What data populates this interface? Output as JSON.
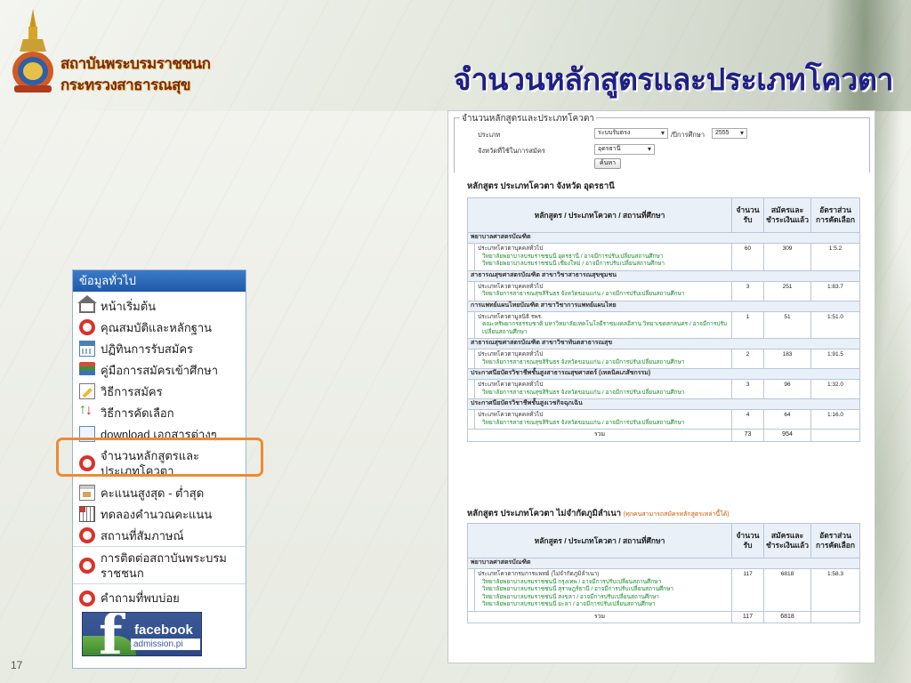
{
  "header": {
    "org_line1": "สถาบันพระบรมราชชนก",
    "org_line2": "กระทรวงสาธารณสุข",
    "slide_title": "จำนวนหลักสูตรและประเภทโควตา",
    "slide_number": "17"
  },
  "sidebar": {
    "title": "ข้อมูลทั่วไป",
    "items": [
      {
        "label": "หน้าเริ่มต้น",
        "icon": "home-icon"
      },
      {
        "label": "คุณสมบัติและหลักฐาน",
        "icon": "lifebuoy-icon"
      },
      {
        "label": "ปฏิทินการรับสมัคร",
        "icon": "calendar-icon"
      },
      {
        "label": "คู่มือการสมัครเข้าศึกษา",
        "icon": "books-icon"
      },
      {
        "label": "วิธีการสมัคร",
        "icon": "pencil-icon"
      },
      {
        "label": "วิธีการคัดเลือก",
        "icon": "updown-arrows-icon"
      },
      {
        "label": "download เอกสารต่างๆ",
        "icon": "document-icon"
      },
      {
        "label": "จำนวนหลักสูตรและประเภทโควตา",
        "icon": "lifebuoy-icon"
      },
      {
        "label": "คะแนนสูงสุด - ต่ำสุด",
        "icon": "chart-icon"
      },
      {
        "label": "ทดลองคำนวณคะแนน",
        "icon": "calculator-icon"
      },
      {
        "label": "สถานที่สัมภาษณ์",
        "icon": "lifebuoy-icon"
      },
      {
        "label": "การติดต่อสถาบันพระบรม ราชชนก",
        "icon": "lifebuoy-icon"
      },
      {
        "label": "คำถามที่พบบ่อย",
        "icon": "lifebuoy-icon"
      }
    ],
    "facebook": {
      "label": "facebook",
      "sub": "admission.pi"
    }
  },
  "panel": {
    "legend": "จำนวนหลักสูตรและประเภทโควตา",
    "filters": {
      "type_label": "ประเภท",
      "type_value": "ระบบรับตรง",
      "year_label": "/ปีการศึกษา",
      "year_value": "2555",
      "province_label": "จังหวัดที่ใช้ในการสมัคร",
      "province_value": "อุดรธานี",
      "search_button": "ค้นหา"
    },
    "section1": {
      "title": "หลักสูตร ประเภทโควตา จังหวัด อุดรธานี",
      "headers": [
        "หลักสูตร / ประเภทโควตา / สถานที่ศึกษา",
        "จำนวนรับ",
        "สมัครและชำระเงินแล้ว",
        "อัตราส่วนการคัดเลือก"
      ],
      "groups": [
        {
          "name": "พยาบาลศาสตรบัณฑิต",
          "rows": [
            {
              "type": "ประเภทโควตาบุคคลทั่วไป",
              "places": [
                "วิทยาลัยพยาบาลบรมราชชนนี อุดรธานี / อาจมีการปรับเปลี่ยนสถานศึกษา",
                "วิทยาลัยพยาบาลบรมราชชนนี เชียงใหม่ / อาจมีการปรับเปลี่ยนสถานศึกษา"
              ],
              "quota": "60",
              "applied": "309",
              "ratio": "1:5.2"
            }
          ]
        },
        {
          "name": "สาธารณสุขศาสตรบัณฑิต สาขาวิชาสาธารณสุขชุมชน",
          "rows": [
            {
              "type": "ประเภทโควตาบุคคลทั่วไป",
              "places": [
                "วิทยาลัยการสาธารณสุขสิรินธร จังหวัดขอนแก่น / อาจมีการปรับเปลี่ยนสถานศึกษา"
              ],
              "quota": "3",
              "applied": "251",
              "ratio": "1:83.7"
            }
          ]
        },
        {
          "name": "การแพทย์แผนไทยบัณฑิต สาขาวิชาการแพทย์แผนไทย",
          "rows": [
            {
              "type": "ประเภทโควตามูลนิธิ รพร.",
              "places": [
                "คณะทรัพยากรธรรมชาติ มหาวิทยาลัยเทคโนโลยีราชมงคลอีสาน วิทยาเขตสกลนคร / อาจมีการปรับเปลี่ยนสถานศึกษา"
              ],
              "quota": "1",
              "applied": "51",
              "ratio": "1:51.0"
            }
          ]
        },
        {
          "name": "สาธารณสุขศาสตรบัณฑิต สาขาวิชาทันตสาธารณสุข",
          "rows": [
            {
              "type": "ประเภทโควตาบุคคลทั่วไป",
              "places": [
                "วิทยาลัยการสาธารณสุขสิรินธร จังหวัดขอนแก่น / อาจมีการปรับเปลี่ยนสถานศึกษา"
              ],
              "quota": "2",
              "applied": "183",
              "ratio": "1:91.5"
            }
          ]
        },
        {
          "name": "ประกาศนียบัตรวิชาชีพชั้นสูงสาธารณสุขศาสตร์ (เทคนิคเภสัชกรรม)",
          "rows": [
            {
              "type": "ประเภทโควตาบุคคลทั่วไป",
              "places": [
                "วิทยาลัยการสาธารณสุขสิรินธร จังหวัดขอนแก่น / อาจมีการปรับเปลี่ยนสถานศึกษา"
              ],
              "quota": "3",
              "applied": "96",
              "ratio": "1:32.0"
            }
          ]
        },
        {
          "name": "ประกาศนียบัตรวิชาชีพชั้นสูงเวชกิจฉุกเฉิน",
          "rows": [
            {
              "type": "ประเภทโควตาบุคคลทั่วไป",
              "places": [
                "วิทยาลัยการสาธารณสุขสิรินธร จังหวัดขอนแก่น / อาจมีการปรับเปลี่ยนสถานศึกษา"
              ],
              "quota": "4",
              "applied": "64",
              "ratio": "1:16.0"
            }
          ]
        }
      ],
      "total_label": "รวม",
      "total_quota": "73",
      "total_applied": "954"
    },
    "section2": {
      "title": "หลักสูตร ประเภทโควตา ไม่จำกัดภูมิลำเนา",
      "note": "(ทุกคนสามารถสมัครหลักสูตรเหล่านี้ได้)",
      "headers": [
        "หลักสูตร / ประเภทโควตา / สถานที่ศึกษา",
        "จำนวนรับ",
        "สมัครและชำระเงินแล้ว",
        "อัตราส่วนการคัดเลือก"
      ],
      "group": "พยาบาลศาสตรบัณฑิต",
      "row": {
        "type": "ประเภทโควตากรมการแพทย์ (ไม่จำกัดภูมิลำเนา)",
        "places": [
          "วิทยาลัยพยาบาลบรมราชชนนี กรุงเทพ / อาจมีการปรับเปลี่ยนสถานศึกษา",
          "วิทยาลัยพยาบาลบรมราชชนนี สุราษฎร์ธานี / อาจมีการปรับเปลี่ยนสถานศึกษา",
          "วิทยาลัยพยาบาลบรมราชชนนี สงขลา / อาจมีการปรับเปลี่ยนสถานศึกษา",
          "วิทยาลัยพยาบาลบรมราชชนนี ยะลา / อาจมีการปรับเปลี่ยนสถานศึกษา"
        ],
        "quota": "117",
        "applied": "6818",
        "ratio": "1:58.3"
      },
      "total_label": "รวม",
      "total_quota": "117",
      "total_applied": "6818"
    }
  }
}
